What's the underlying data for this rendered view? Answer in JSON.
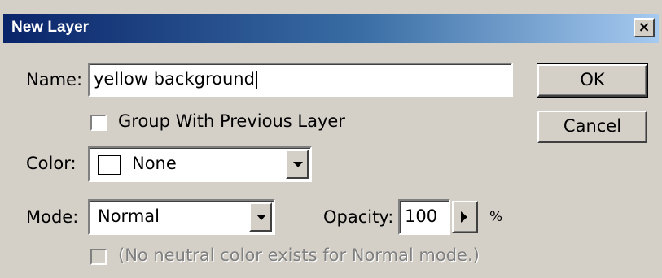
{
  "dialog": {
    "title": "New Layer",
    "close_glyph": "×"
  },
  "form": {
    "name_label": "Name:",
    "name_value": "yellow background",
    "group_label": "Group With Previous Layer",
    "group_checked": false,
    "color_label": "Color:",
    "color_value": "None",
    "mode_label": "Mode:",
    "mode_value": "Normal",
    "opacity_label": "Opacity:",
    "opacity_value": "100",
    "opacity_unit": "%",
    "neutral_label": "(No neutral color exists for Normal mode.)",
    "neutral_checked": false
  },
  "buttons": {
    "ok_label": "OK",
    "cancel_label": "Cancel"
  },
  "colors": {
    "dialog_bg": "#d4d0c8",
    "title_gradient_start": "#0a246a",
    "title_gradient_end": "#a6caf0",
    "disabled_text": "#808080"
  },
  "icons": {
    "close": "close-icon",
    "dropdown": "chevron-down-icon",
    "slider_popup": "triangle-right-icon"
  }
}
